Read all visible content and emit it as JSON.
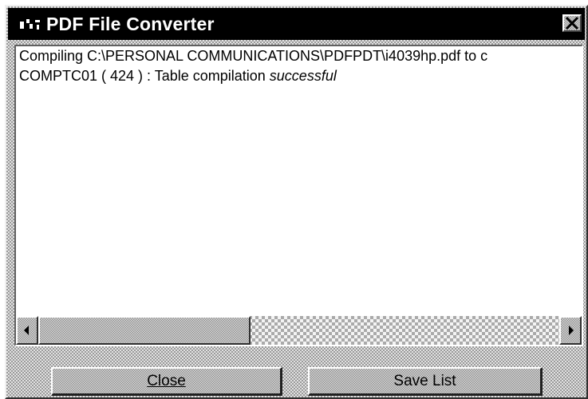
{
  "window": {
    "title": "PDF File Converter",
    "app_icon": "converter-app-icon",
    "close_icon": "close-x-icon"
  },
  "log": {
    "lines": [
      {
        "prefix": "Compiling C:\\PERSONAL COMMUNICATIONS\\PDFPDT\\i4039hp.pdf to c",
        "emphasis": ""
      },
      {
        "prefix": "COMPTC01 ( 424 ) : Table compilation ",
        "emphasis": "successful"
      }
    ]
  },
  "scrollbar": {
    "left_arrow_icon": "left-arrow-icon",
    "right_arrow_icon": "right-arrow-icon"
  },
  "buttons": {
    "close_label": "Close",
    "save_label": "Save List"
  },
  "colors": {
    "titlebar_bg": "#000000",
    "titlebar_text": "#ffffff",
    "dialog_bg": "#c0c0c0",
    "list_bg": "#ffffff"
  }
}
